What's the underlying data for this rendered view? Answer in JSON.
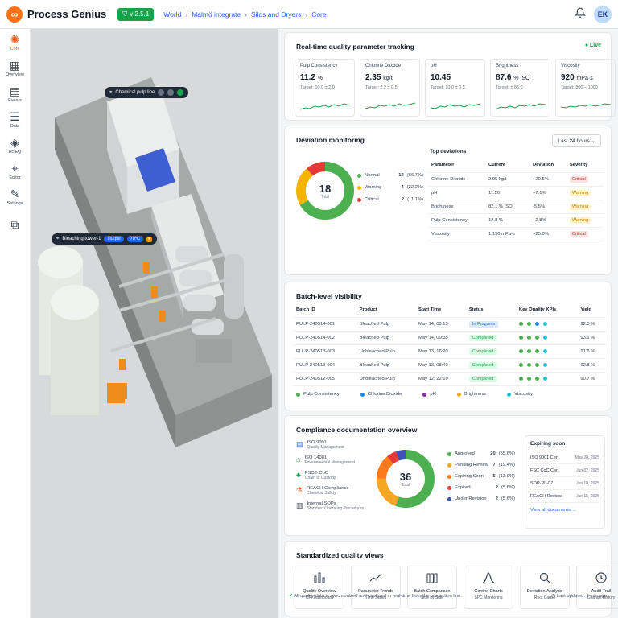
{
  "topbar": {
    "brand": "Process Genius",
    "version": "v 2.5.1",
    "breadcrumb": [
      "World",
      "Malmö integrate",
      "Silos and Dryers",
      "Core"
    ],
    "avatar": "EK"
  },
  "sidebar": {
    "items": [
      {
        "label": "Core",
        "icon": "core-icon"
      },
      {
        "label": "Overview",
        "icon": "grid-icon"
      },
      {
        "label": "Events",
        "icon": "calendar-icon"
      },
      {
        "label": "Data",
        "icon": "list-icon"
      },
      {
        "label": "HSEQ",
        "icon": "layers-icon"
      },
      {
        "label": "Editor",
        "icon": "pin-icon"
      },
      {
        "label": "Settings",
        "icon": "wrench-icon"
      }
    ]
  },
  "viewer": {
    "tag1": {
      "label": "Chemical pulp line"
    },
    "tag2": {
      "label": "Bleaching tower-1",
      "pressure": "162psi",
      "temp": "70°C"
    }
  },
  "quality": {
    "title": "Real-time quality parameter tracking",
    "live": "● Live",
    "kpis": [
      {
        "name": "Pulp Consistency",
        "value": "11.2",
        "unit": "%",
        "target": "Target: 10.0 ± 2.0"
      },
      {
        "name": "Chlorine Dioxide",
        "value": "2.35",
        "unit": "kg/t",
        "target": "Target: 2.2 ± 0.5"
      },
      {
        "name": "pH",
        "value": "10.45",
        "unit": "",
        "target": "Target: 10.0 ± 0.5"
      },
      {
        "name": "Brightness",
        "value": "87.6",
        "unit": "% ISO",
        "target": "Target: ± 85.0"
      },
      {
        "name": "Viscosity",
        "value": "920",
        "unit": "mPa·s",
        "target": "Target: 800 – 1000"
      }
    ]
  },
  "deviation": {
    "title": "Deviation monitoring",
    "range": "Last 24 hours",
    "total": "18",
    "total_label": "Total",
    "legend": [
      {
        "label": "Normal",
        "count": "12",
        "pct": "(66.7%)",
        "color": "#4caf50",
        "value": 12
      },
      {
        "label": "Warning",
        "count": "4",
        "pct": "(22.2%)",
        "color": "#f5b400",
        "value": 4
      },
      {
        "label": "Critical",
        "count": "2",
        "pct": "(11.1%)",
        "color": "#e53935",
        "value": 2
      }
    ],
    "top_title": "Top deviations",
    "columns": [
      "Parameter",
      "Current",
      "Deviation",
      "Severity"
    ],
    "rows": [
      {
        "param": "Chlorine Dioxide",
        "current": "2.95 kg/t",
        "dev": "+29.5%",
        "sev": "Critical"
      },
      {
        "param": "pH",
        "current": "11.20",
        "dev": "+7.1%",
        "sev": "Warning"
      },
      {
        "param": "Brightness",
        "current": "82.1 % ISO",
        "dev": "-5.5%",
        "sev": "Warning"
      },
      {
        "param": "Pulp Consistency",
        "current": "12.8 %",
        "dev": "+2.8%",
        "sev": "Warning"
      },
      {
        "param": "Viscosity",
        "current": "1,150 mPa·s",
        "dev": "+25.0%",
        "sev": "Critical"
      }
    ]
  },
  "batch": {
    "title": "Batch-level visibility",
    "columns": [
      "Batch ID",
      "Product",
      "Start Time",
      "Status",
      "Key Quality KPIs",
      "Yield"
    ],
    "rows": [
      {
        "id": "PULP-240514-001",
        "product": "Bleached Pulp",
        "start": "May 14, 08:15",
        "status": "In Progress",
        "yield": "92.3 %"
      },
      {
        "id": "PULP-240514-002",
        "product": "Bleached Pulp",
        "start": "May 14, 00:35",
        "status": "Completed",
        "yield": "93.1 %"
      },
      {
        "id": "PULP-240513-003",
        "product": "Unbleached Pulp",
        "start": "May 13, 16:20",
        "status": "Completed",
        "yield": "91.6 %"
      },
      {
        "id": "PULP-240513-004",
        "product": "Bleached Pulp",
        "start": "May 13, 08:40",
        "status": "Completed",
        "yield": "92.8 %"
      },
      {
        "id": "PULP-240512-005",
        "product": "Unbleached Pulp",
        "start": "May 12, 22:10",
        "status": "Completed",
        "yield": "90.7 %"
      }
    ],
    "legend": [
      {
        "label": "Pulp Consistency",
        "color": "#4caf50"
      },
      {
        "label": "Chlorine Dioxide",
        "color": "#1e88e5"
      },
      {
        "label": "pH",
        "color": "#8e24aa"
      },
      {
        "label": "Brightness",
        "color": "#f5a623"
      },
      {
        "label": "Viscosity",
        "color": "#26c6da"
      }
    ]
  },
  "compliance": {
    "title": "Compliance documentation overview",
    "docs": [
      {
        "name": "ISO 9001",
        "sub": "Quality Management"
      },
      {
        "name": "ISO 14001",
        "sub": "Environmental Management"
      },
      {
        "name": "FSC® CoC",
        "sub": "Chain of Custody"
      },
      {
        "name": "REACH Compliance",
        "sub": "Chemical Safety"
      },
      {
        "name": "Internal SOPs",
        "sub": "Standard Operating Procedures"
      }
    ],
    "total": "36",
    "total_label": "Total",
    "legend": [
      {
        "label": "Approved",
        "count": "20",
        "pct": "(55.6%)",
        "color": "#4caf50",
        "value": 20
      },
      {
        "label": "Pending Review",
        "count": "7",
        "pct": "(19.4%)",
        "color": "#f5a623",
        "value": 7
      },
      {
        "label": "Expiring Soon",
        "count": "5",
        "pct": "(13.9%)",
        "color": "#ff7a1a",
        "value": 5
      },
      {
        "label": "Expired",
        "count": "2",
        "pct": "(5.6%)",
        "color": "#e53935",
        "value": 2
      },
      {
        "label": "Under Revision",
        "count": "2",
        "pct": "(5.6%)",
        "color": "#3f51b5",
        "value": 2
      }
    ],
    "expiring_title": "Expiring soon",
    "expiring": [
      {
        "name": "ISO 9001 Cert",
        "date": "May 28, 2025"
      },
      {
        "name": "FSC CoC Cert",
        "date": "Jun 02, 2025"
      },
      {
        "name": "SOP-PL-07",
        "date": "Jun 10, 2025"
      },
      {
        "name": "REACH Review",
        "date": "Jun 15, 2025"
      }
    ],
    "view_all": "View all documents →"
  },
  "views": {
    "title": "Standardized quality views",
    "items": [
      {
        "title": "Quality Overview",
        "sub": "KPI Dashboard",
        "icon": "bar-chart-icon"
      },
      {
        "title": "Parameter Trends",
        "sub": "Time Series",
        "icon": "trend-icon"
      },
      {
        "title": "Batch Comparison",
        "sub": "Side by Side",
        "icon": "compare-icon"
      },
      {
        "title": "Control Charts",
        "sub": "SPC Monitoring",
        "icon": "bell-curve-icon"
      },
      {
        "title": "Deviation Analysis",
        "sub": "Root Cause",
        "icon": "magnifier-icon"
      },
      {
        "title": "Audit Trail",
        "sub": "Change History",
        "icon": "history-icon"
      }
    ]
  },
  "footer": {
    "sync": "All quality data is synchronized and captured in real-time from the production line.",
    "updated": "Last updated: 2 min ago"
  }
}
